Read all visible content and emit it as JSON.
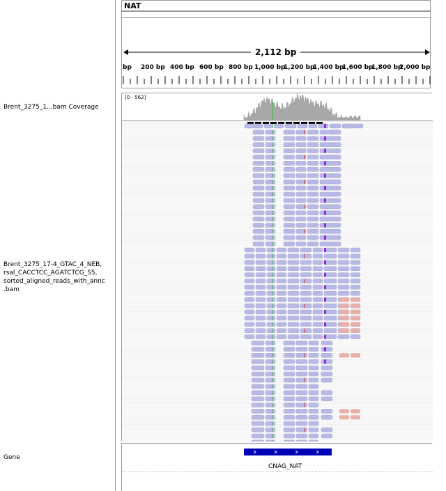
{
  "header": {
    "chromosome_name": "NAT",
    "span_label": "2,112 bp"
  },
  "ruler": {
    "ticks": [
      "bp",
      "200 bp",
      "400 bp",
      "600 bp",
      "800 bp",
      "1,000 bp",
      "1,200 bp",
      "1,400 bp",
      "1,600 bp",
      "1,800 bp",
      "2,000 bp"
    ]
  },
  "tracks": {
    "coverage_name": "Brent_3275_1...bam Coverage",
    "coverage_range": "[0 - 562]",
    "alignment_name_lines": [
      "Brent_3275_17-4_GTAC_4_NEB,",
      "rsal_CACCTCC_AGATCTCG_S5,",
      "sorted_aligned_reads_with_annc",
      ".bam"
    ],
    "gene_track_name": "Gene",
    "gene_label": "CNAG_NAT"
  },
  "colors": {
    "read_fill": "#b9b9e6",
    "read_mismatch_fill": "#e8b0a8",
    "coverage_fill": "#a8a8a8",
    "gene_fill": "#0000b4",
    "insertion_mark": "#8a2be2"
  }
}
